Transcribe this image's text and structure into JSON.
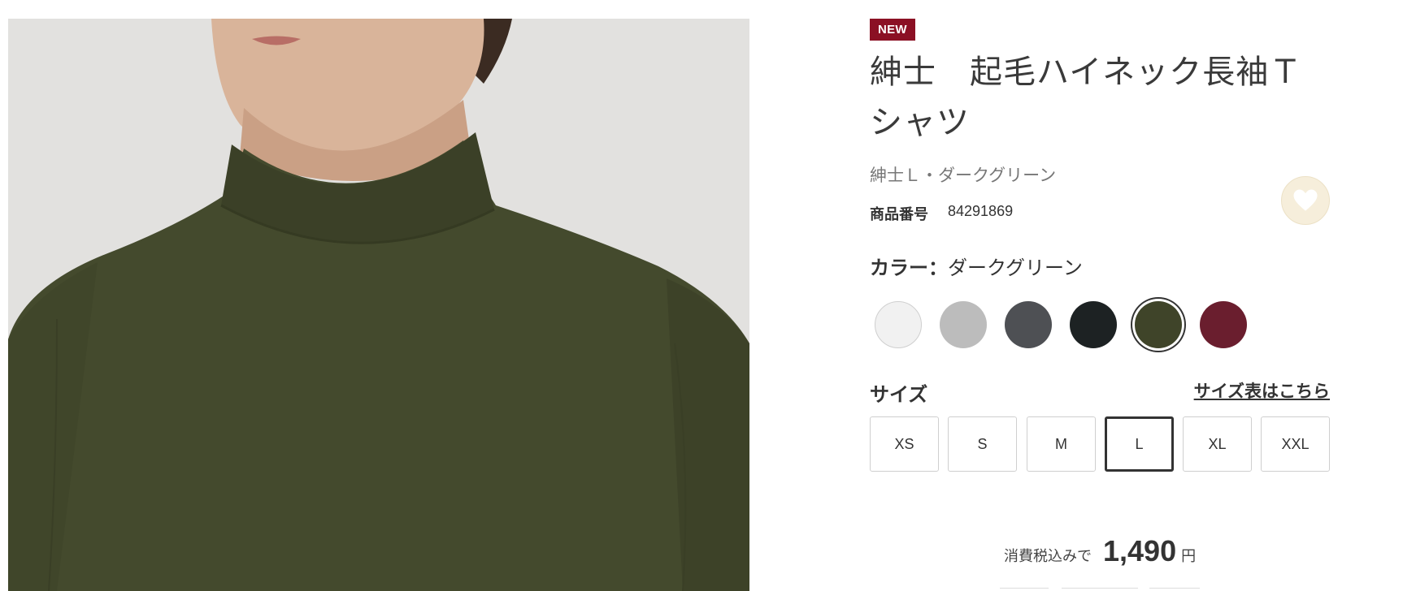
{
  "product": {
    "badge": "NEW",
    "title": "紳士　起毛ハイネック長袖Ｔシャツ",
    "variant": "紳士Ｌ・ダークグリーン",
    "code_label": "商品番号",
    "code_value": "84291869"
  },
  "favorite": {
    "icon": "heart-icon"
  },
  "color": {
    "label": "カラー：",
    "selected": "ダークグリーン",
    "swatches": [
      {
        "name": "white",
        "hex": "#f1f1f1"
      },
      {
        "name": "light-gray",
        "hex": "#bcbcbc"
      },
      {
        "name": "charcoal",
        "hex": "#4e5054"
      },
      {
        "name": "black",
        "hex": "#1d2223"
      },
      {
        "name": "dark-green",
        "hex": "#3f4429",
        "selected": true
      },
      {
        "name": "wine",
        "hex": "#6a1e2e"
      }
    ]
  },
  "size": {
    "label": "サイズ",
    "chart_link": "サイズ表はこちら",
    "options": [
      "XS",
      "S",
      "M",
      "L",
      "XL",
      "XXL"
    ],
    "selected": "L"
  },
  "price": {
    "prefix": "消費税込みで",
    "value": "1,490",
    "unit": "円"
  },
  "colors": {
    "badge": "#8b1024",
    "favorite_bg": "#f6eedb"
  }
}
